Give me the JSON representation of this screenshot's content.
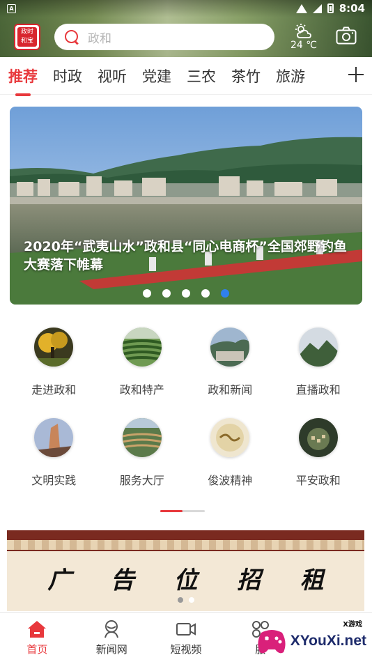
{
  "status_bar": {
    "time": "8:04"
  },
  "header": {
    "logo_text": "政和\n和宝",
    "search_placeholder": "政和",
    "weather_temp": "24 ℃"
  },
  "tabs": [
    {
      "label": "推荐",
      "active": true
    },
    {
      "label": "时政"
    },
    {
      "label": "视听"
    },
    {
      "label": "党建"
    },
    {
      "label": "三农"
    },
    {
      "label": "茶竹"
    },
    {
      "label": "旅游"
    }
  ],
  "banner": {
    "title": "2020年“武夷山水”政和县“同心电商杯”全国郊野钓鱼大赛落下帷幕",
    "dots": 5,
    "active_dot": 4
  },
  "grid": [
    {
      "label": "走进政和",
      "icon": "autumn-tree-icon"
    },
    {
      "label": "政和特产",
      "icon": "tea-field-icon"
    },
    {
      "label": "政和新闻",
      "icon": "town-view-icon"
    },
    {
      "label": "直播政和",
      "icon": "mountain-icon"
    },
    {
      "label": "文明实践",
      "icon": "rock-peak-icon"
    },
    {
      "label": "服务大厅",
      "icon": "terrace-icon"
    },
    {
      "label": "俊波精神",
      "icon": "calligraphy-icon"
    },
    {
      "label": "平安政和",
      "icon": "village-icon"
    }
  ],
  "ad": {
    "chars": [
      "广",
      "告",
      "位",
      "招",
      "租"
    ]
  },
  "nav": [
    {
      "label": "首页",
      "icon": "home-icon",
      "active": true
    },
    {
      "label": "新闻网",
      "icon": "news-icon"
    },
    {
      "label": "短视频",
      "icon": "video-icon"
    },
    {
      "label": "服",
      "icon": "service-icon"
    }
  ],
  "watermark": {
    "small": "X游戏",
    "text": "XYouXi.net"
  },
  "colors": {
    "accent": "#e8383c",
    "dot_active": "#2f80ed"
  }
}
